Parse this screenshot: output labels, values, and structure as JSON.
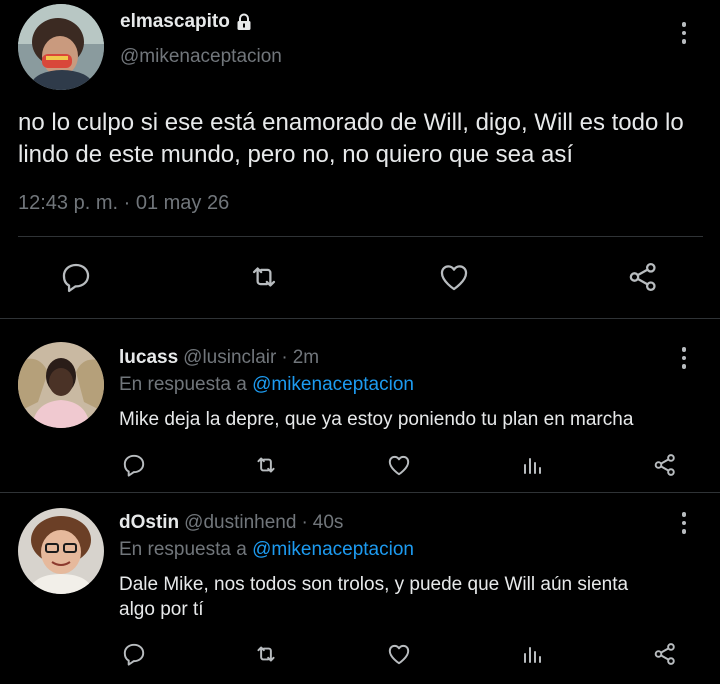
{
  "main_tweet": {
    "display_name": "elmascapito",
    "handle": "@mikenaceptacion",
    "text": "no lo culpo si ese está enamorado de Will, digo, Will es todo lo lindo de este mundo, pero no, no quiero que sea así",
    "timestamp": "12:43 p. m. · 01 may 26",
    "icons": [
      "lock-icon",
      "more-icon",
      "reply-icon",
      "retweet-icon",
      "like-icon",
      "share-icon"
    ]
  },
  "replies": [
    {
      "display_name": "lucass",
      "handle": "@lusinclair",
      "age": "2m",
      "reply_label": "En respuesta a",
      "reply_target": "@mikenaceptacion",
      "text": "Mike deja la depre, que ya estoy poniendo tu plan en marcha"
    },
    {
      "display_name": "dOstin",
      "handle": "@dustinhend",
      "age": "40s",
      "reply_label": "En respuesta a",
      "reply_target": "@mikenaceptacion",
      "text": "Dale Mike, nos todos son trolos, y puede que Will aún sienta algo por tí"
    }
  ],
  "colors": {
    "background": "#000000",
    "text": "#e7e9ea",
    "muted": "#71767b",
    "link": "#1d9bf0",
    "divider": "#2f3336"
  }
}
